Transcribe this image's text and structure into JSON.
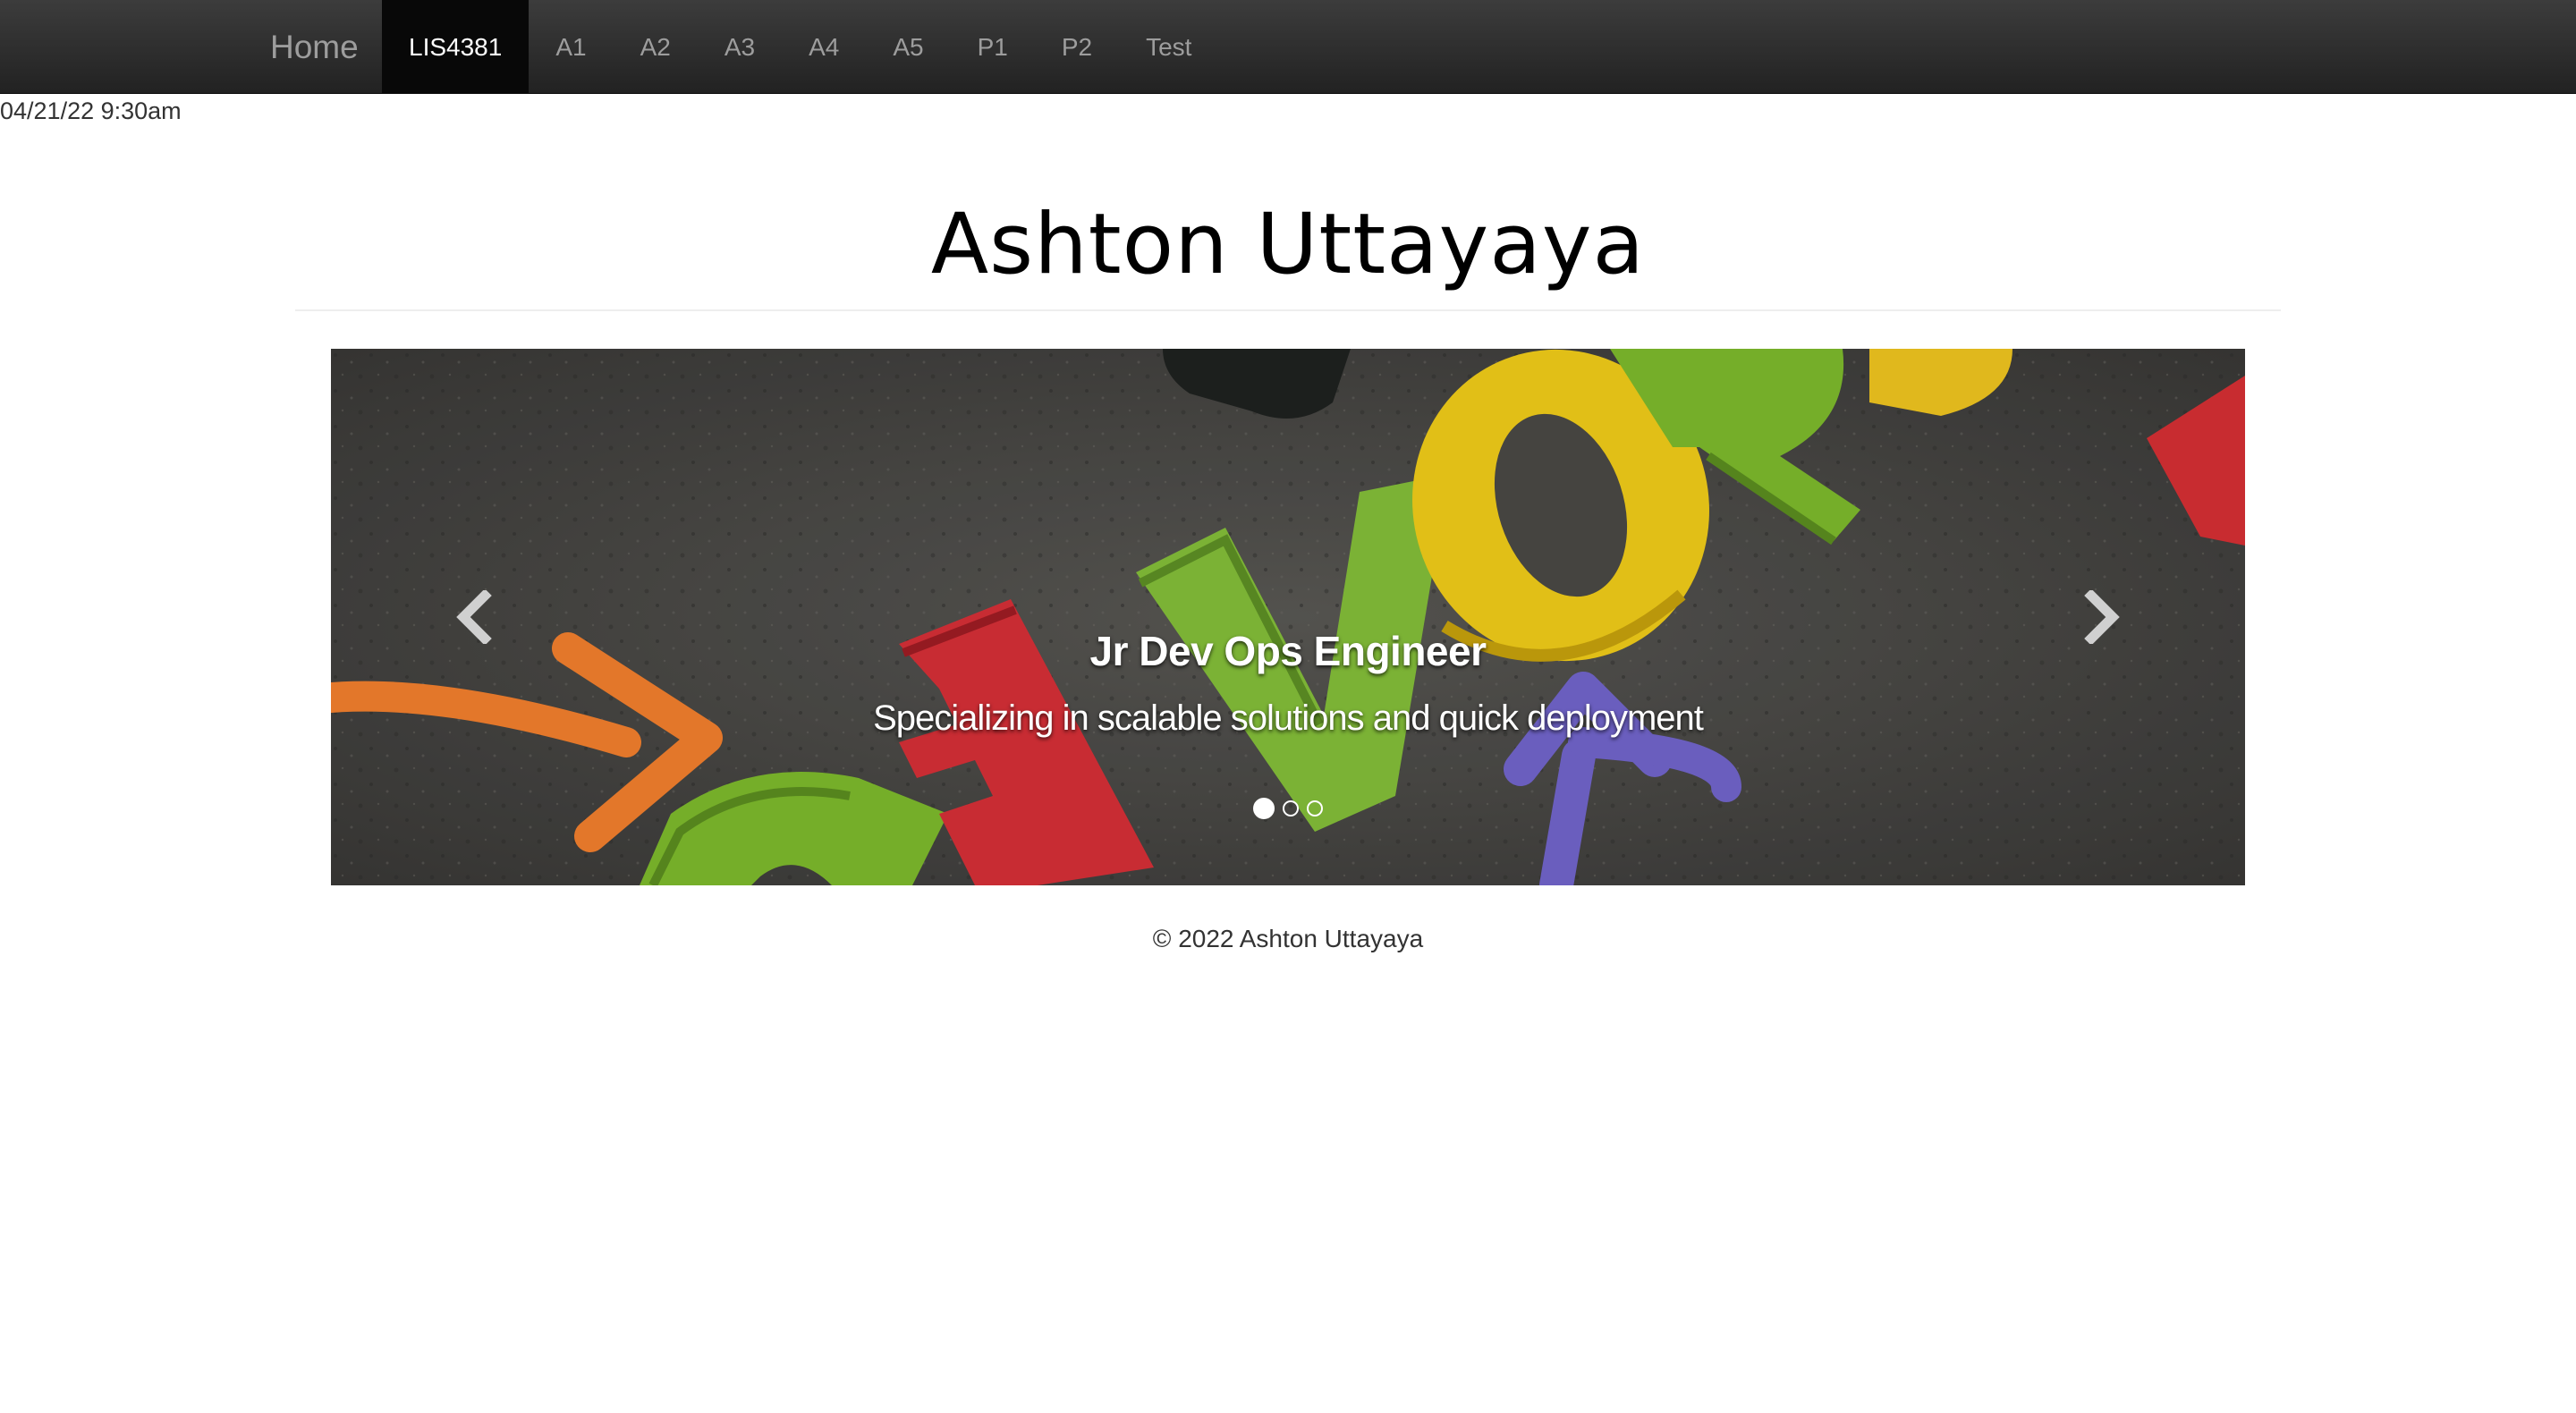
{
  "navbar": {
    "brand": "Home",
    "items": [
      {
        "label": "LIS4381",
        "active": true
      },
      {
        "label": "A1",
        "active": false
      },
      {
        "label": "A2",
        "active": false
      },
      {
        "label": "A3",
        "active": false
      },
      {
        "label": "A4",
        "active": false
      },
      {
        "label": "A5",
        "active": false
      },
      {
        "label": "P1",
        "active": false
      },
      {
        "label": "P2",
        "active": false
      },
      {
        "label": "Test",
        "active": false
      }
    ]
  },
  "timestamp": "04/21/22 9:30am",
  "header": {
    "title": "Ashton Uttayaya"
  },
  "carousel": {
    "caption_title": "Jr Dev Ops Engineer",
    "caption_text": "Specializing in scalable solutions and quick deployment",
    "slide_count": 3,
    "active_slide": 1,
    "prev_icon": "chevron-left-icon",
    "next_icon": "chevron-right-icon"
  },
  "footer": {
    "copyright": "© 2022 Ashton Uttayaya"
  },
  "colors": {
    "navbar_bg": "#222222",
    "nav_active_bg": "#080808",
    "nav_text": "#9d9d9d"
  }
}
